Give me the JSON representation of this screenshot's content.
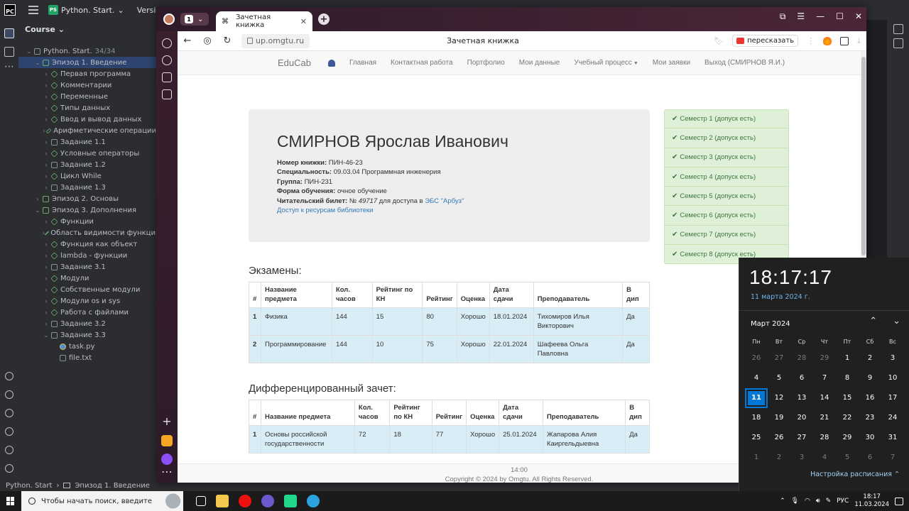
{
  "ide": {
    "project": "Python. Start.",
    "vcs": "Version contro",
    "panel_title": "Course",
    "root": "Python. Start.",
    "root_count": "34/34",
    "tree": [
      {
        "label": "Эпизод 1. Введение",
        "level": 1,
        "open": true,
        "sel": true,
        "icon": "folder"
      },
      {
        "label": "Первая программа",
        "level": 2,
        "icon": "lesson"
      },
      {
        "label": "Комментарии",
        "level": 2,
        "icon": "lesson"
      },
      {
        "label": "Переменные",
        "level": 2,
        "icon": "lesson"
      },
      {
        "label": "Типы данных",
        "level": 2,
        "icon": "lesson"
      },
      {
        "label": "Ввод и вывод данных",
        "level": 2,
        "icon": "lesson"
      },
      {
        "label": "Арифметические операции",
        "level": 2,
        "icon": "lesson"
      },
      {
        "label": "Задание 1.1",
        "level": 2,
        "icon": "task"
      },
      {
        "label": "Условные операторы",
        "level": 2,
        "icon": "lesson"
      },
      {
        "label": "Задание 1.2",
        "level": 2,
        "icon": "task"
      },
      {
        "label": "Цикл While",
        "level": 2,
        "icon": "lesson"
      },
      {
        "label": "Задание 1.3",
        "level": 2,
        "icon": "task"
      },
      {
        "label": "Эпизод 2. Основы",
        "level": 1,
        "icon": "folder"
      },
      {
        "label": "Эпизод 3. Дополнения",
        "level": 1,
        "open": true,
        "icon": "folder"
      },
      {
        "label": "Функции",
        "level": 2,
        "icon": "lesson"
      },
      {
        "label": "Область видимости функции",
        "level": 2,
        "icon": "lesson"
      },
      {
        "label": "Функция как объект",
        "level": 2,
        "icon": "lesson"
      },
      {
        "label": "lambda - функции",
        "level": 2,
        "icon": "lesson"
      },
      {
        "label": "Задание 3.1",
        "level": 2,
        "icon": "task"
      },
      {
        "label": "Модули",
        "level": 2,
        "icon": "lesson"
      },
      {
        "label": "Собственные модули",
        "level": 2,
        "icon": "lesson"
      },
      {
        "label": "Модули os и sys",
        "level": 2,
        "icon": "lesson"
      },
      {
        "label": "Работа с файлами",
        "level": 2,
        "icon": "lesson"
      },
      {
        "label": "Задание 3.2",
        "level": 2,
        "icon": "task"
      },
      {
        "label": "Задание 3.3",
        "level": 2,
        "open": true,
        "icon": "task"
      },
      {
        "label": "task.py",
        "level": 3,
        "icon": "py"
      },
      {
        "label": "file.txt",
        "level": 3,
        "icon": "file"
      }
    ],
    "status": {
      "project": "Python. Start",
      "path": "Эпизод 1. Введение"
    }
  },
  "browser": {
    "tab_count": "1",
    "tab_title": "Зачетная книжка",
    "url": "up.omgtu.ru",
    "page_title": "Зачетная книжка",
    "retell": "пересказать"
  },
  "site": {
    "brand": "EduCab",
    "nav": [
      "Главная",
      "Контактная работа",
      "Портфолио",
      "Мои данные",
      "Учебный процесс",
      "Мои заявки",
      "Выход (СМИРНОВ Я.И.)"
    ],
    "student": {
      "name": "СМИРНОВ Ярослав Иванович",
      "book_label": "Номер книжки:",
      "book": "ПИН-46-23",
      "spec_label": "Специальность:",
      "spec": "09.03.04 Программная инженерия",
      "group_label": "Группа:",
      "group": "ПИН-231",
      "form_label": "Форма обучения:",
      "form": "очное обучение",
      "ticket_label": "Читательский билет:",
      "ticket_prefix": "№",
      "ticket": "49717",
      "ticket_mid": "для доступа в",
      "ebs": "ЭБС \"Арбуз\"",
      "library_link": "Доступ к ресурсам библиотеки"
    },
    "semesters": [
      "Семестр 1 (допуск есть)",
      "Семестр 2 (допуск есть)",
      "Семестр 3 (допуск есть)",
      "Семестр 4 (допуск есть)",
      "Семестр 5 (допуск есть)",
      "Семестр 6 (допуск есть)",
      "Семестр 7 (допуск есть)",
      "Семестр 8 (допуск есть)"
    ],
    "exams": {
      "title": "Экзамены:",
      "headers": [
        "#",
        "Название предмета",
        "Кол. часов",
        "Рейтинг по КН",
        "Рейтинг",
        "Оценка",
        "Дата сдачи",
        "Преподаватель",
        "В дип"
      ],
      "rows": [
        [
          "1",
          "Физика",
          "144",
          "15",
          "80",
          "Хорошо",
          "18.01.2024",
          "Тихомиров Илья Викторович",
          "Да"
        ],
        [
          "2",
          "Программирование",
          "144",
          "10",
          "75",
          "Хорошо",
          "22.01.2024",
          "Шафеева Ольга Павловна",
          "Да"
        ]
      ]
    },
    "diff": {
      "title": "Дифференцированный зачет:",
      "headers": [
        "#",
        "Название предмета",
        "Кол. часов",
        "Рейтинг по КН",
        "Рейтинг",
        "Оценка",
        "Дата сдачи",
        "Преподаватель",
        "В дип"
      ],
      "rows": [
        [
          "1",
          "Основы российской государственности",
          "72",
          "18",
          "77",
          "Хорошо",
          "25.01.2024",
          "Жапарова Алия Каиргельдыевна",
          "Да"
        ]
      ]
    },
    "footer_time": "14:00",
    "footer_copy": "Copyright © 2024 by Omgtu. All Rights Reserved."
  },
  "calendar": {
    "time": "18:17:17",
    "date": "11 марта 2024 г.",
    "month": "Март 2024",
    "dow": [
      "Пн",
      "Вт",
      "Ср",
      "Чт",
      "Пт",
      "Сб",
      "Вс"
    ],
    "days": [
      [
        "26",
        "27",
        "28",
        "29",
        "1",
        "2",
        "3"
      ],
      [
        "4",
        "5",
        "6",
        "7",
        "8",
        "9",
        "10"
      ],
      [
        "11",
        "12",
        "13",
        "14",
        "15",
        "16",
        "17"
      ],
      [
        "18",
        "19",
        "20",
        "21",
        "22",
        "23",
        "24"
      ],
      [
        "25",
        "26",
        "27",
        "28",
        "29",
        "30",
        "31"
      ],
      [
        "1",
        "2",
        "3",
        "4",
        "5",
        "6",
        "7"
      ]
    ],
    "today": "11",
    "schedule": "Настройка расписания"
  },
  "taskbar": {
    "search_placeholder": "Чтобы начать поиск, введите",
    "lang": "РУС",
    "time": "18:17",
    "date": "11.03.2024"
  },
  "colors": {
    "accent": "#0078d7",
    "success_bg": "#dff0d8",
    "row_info": "#d9edf7"
  }
}
